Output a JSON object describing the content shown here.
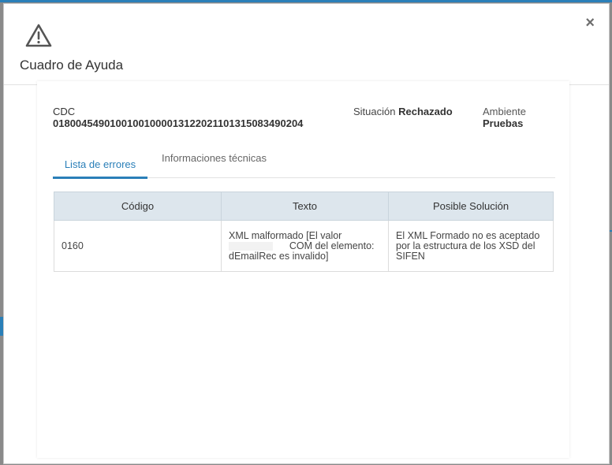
{
  "modal": {
    "title": "Cuadro de Ayuda",
    "close_label": "×"
  },
  "info": {
    "cdc_label": "CDC",
    "cdc_value": "01800454901001001000013122021101315083490204",
    "situacion_label": "Situación",
    "situacion_value": "Rechazado",
    "ambiente_label": "Ambiente",
    "ambiente_value": "Pruebas"
  },
  "tabs": [
    {
      "label": "Lista de errores",
      "active": true
    },
    {
      "label": "Informaciones técnicas",
      "active": false
    }
  ],
  "table": {
    "headers": [
      "Código",
      "Texto",
      "Posible Solución"
    ],
    "rows": [
      {
        "codigo": "0160",
        "texto_1": "XML malformado [El valor",
        "texto_2": "COM del elemento:",
        "texto_3": "dEmailRec es invalido]",
        "solucion_1": "El XML Formado no es aceptado",
        "solucion_2": "por la estructura de los XSD del",
        "solucion_3": "SIFEN"
      }
    ]
  },
  "colors": {
    "accent": "#2a7fb8",
    "header_bg": "#dde6ed"
  },
  "icons": {
    "warning": "warning-triangle-icon",
    "close": "close-icon"
  }
}
